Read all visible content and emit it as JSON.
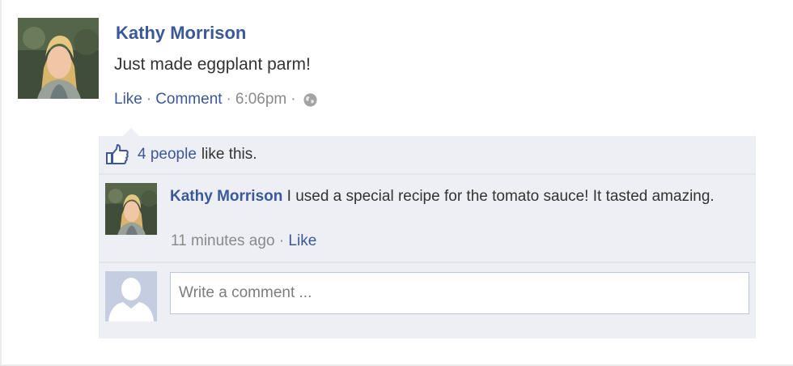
{
  "post": {
    "author": "Kathy Morrison",
    "text": "Just made eggplant parm!",
    "actions": {
      "like": "Like",
      "comment": "Comment"
    },
    "separator": "·",
    "time": "6:06pm",
    "privacy_icon": "globe-icon"
  },
  "likes": {
    "icon": "thumbs-up-icon",
    "count_label": "4 people",
    "suffix": "like this."
  },
  "comment": {
    "author": "Kathy Morrison",
    "text": "I used a special recipe for the tomato sauce! It tasted amazing.",
    "time": "11 minutes ago",
    "separator": "·",
    "like": "Like"
  },
  "compose": {
    "placeholder": "Write a comment ..."
  },
  "colors": {
    "link": "#3b5998",
    "panel": "#edeff4",
    "meta": "#8a8a8a"
  }
}
